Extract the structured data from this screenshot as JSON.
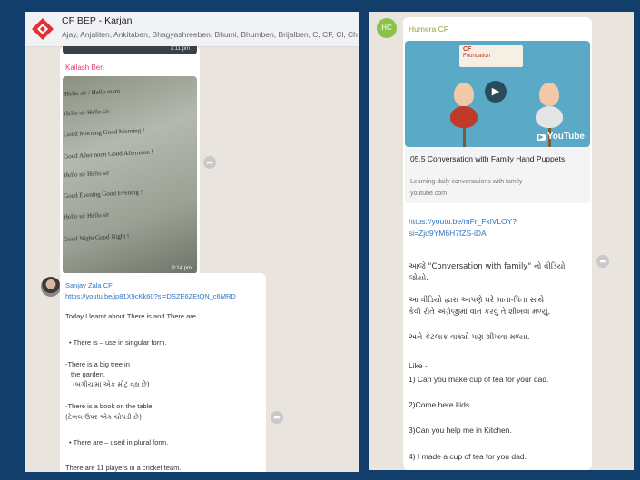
{
  "left_chat": {
    "group_name": "CF BEP - Karjan",
    "members": "Ajay, Anjaliten, Ankitaben, Bhagyashreeben, Bhumi, Bhumben, Brijalben, C, CF, Cl, Chirag, D",
    "image_message": {
      "top_time": "3:11 pm",
      "sender": "Kailash Ben",
      "photo_lines": [
        "Hello sir / Hello mam",
        "Hello sir  Hello sir",
        "Good Morning Good Morning !",
        "Good After noon Good Afternoon !",
        "Hello sir Hello sir",
        "Good Evening Good Evening !",
        "Hello sir Hello sir",
        "Good Night Good Night !"
      ],
      "time": "9:14 pm"
    },
    "text_message": {
      "sender": "Sanjay Zala CF",
      "link": "https://youtu.be/jp81X9cKk60?si=DSZE6ZEtQN_c6MRD",
      "lines": [
        "Today I learnt about There is and There are",
        "• There is – use in singular form.",
        "-There is a big tree in",
        "the garden.",
        "-There is a book on the table.",
        "• There are – used in plural form.",
        "There are 11 players in a cricket team."
      ],
      "gujarati": [
        "(બગીચામાં એક મોટું વૃક્ષ છે)",
        "(ટેબલ ઉપર એક ચોપડી છે)"
      ]
    },
    "share_icon": "share-arrow-icon"
  },
  "right_chat": {
    "avatar_initials": "HC",
    "sender": "Humera CF",
    "video": {
      "banner": "Foundation",
      "banner_top": "CF",
      "platform": "YouTube",
      "title": "05.5 Conversation with Family Hand Puppets",
      "description": "Learning daily conversations with family",
      "domain": "youtube.com"
    },
    "link": "https://youtu.be/mFr_FxlVLOY?si=Zjd9YM6H7fZS-iDA",
    "paragraphs": [
      "આજે \"Conversation with family\" નો વીડિયો",
      "જોયો.",
      "આ વીડિયો દ્વારા આપણે ઘરે માતા-પિતા સાથે",
      "કેવી રીતે અંગ્રેજીમાં વાત કરવું તે શીખવા મળ્યું.",
      "અને કેટલાક વાક્યો પણ શીખવા મળ્યા."
    ],
    "list_intro": "Like -",
    "list": [
      "1) Can you make cup of tea for your dad.",
      "2)Come here kids.",
      "3)Can you help me in Kitchen.",
      "4) I made a cup of tea for you dad."
    ]
  },
  "colors": {
    "frame": "#123e6b",
    "chat_bg": "#e9e4dd",
    "link": "#2f74c0",
    "kailash": "#e33b6f",
    "humera": "#93a33a",
    "avatar_hc": "#8bc34a"
  }
}
